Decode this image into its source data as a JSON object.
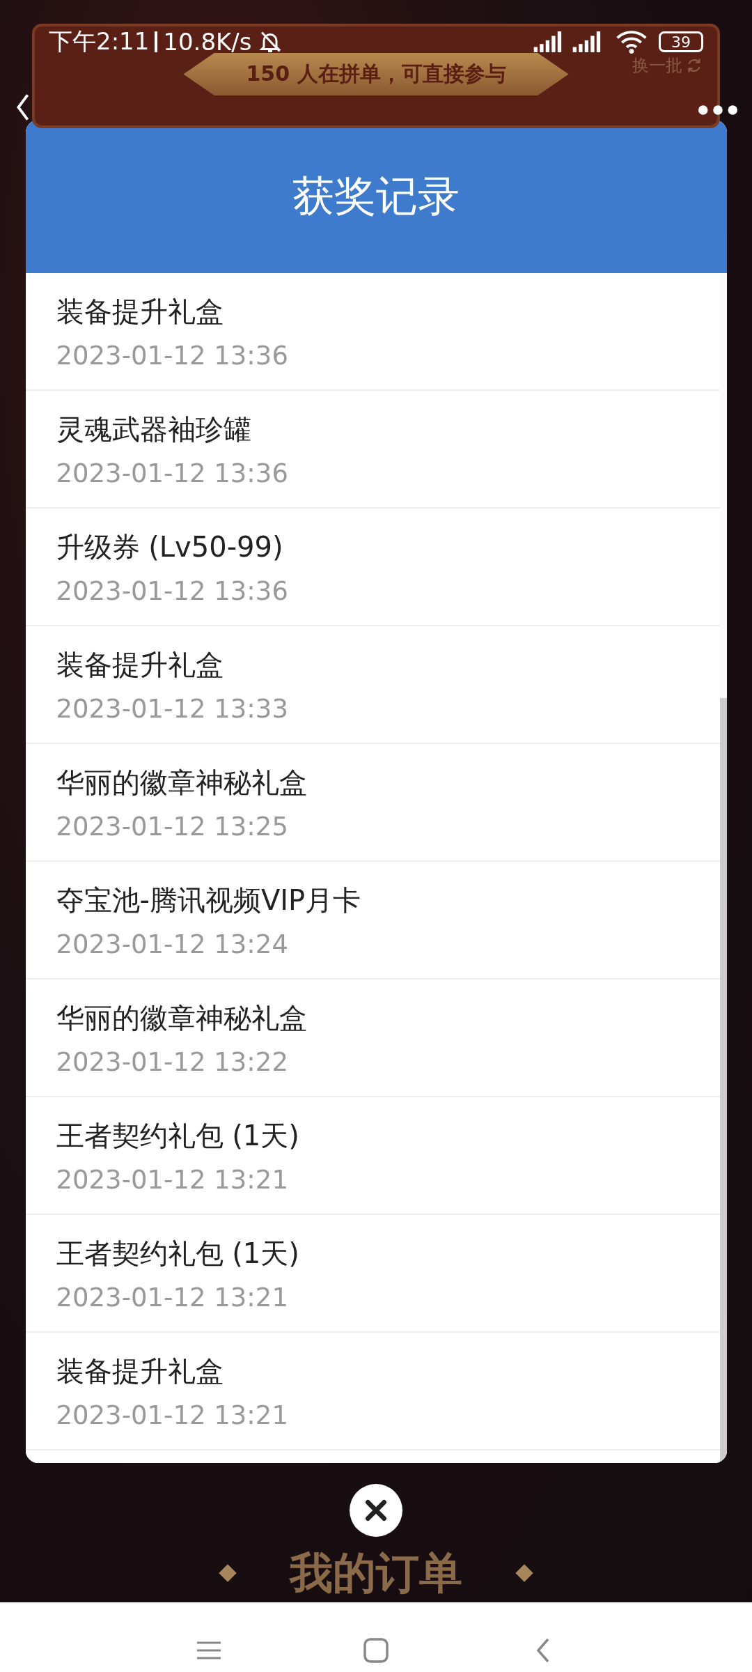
{
  "status_bar": {
    "time": "下午2:11",
    "speed": "10.8K/s",
    "battery": "39"
  },
  "banner": {
    "text": "150 人在拼单，可直接参与",
    "refresh": "换一批"
  },
  "modal": {
    "title": "获奖记录",
    "records": [
      {
        "name": "装备提升礼盒",
        "time": "2023-01-12 13:36"
      },
      {
        "name": "灵魂武器袖珍罐",
        "time": "2023-01-12 13:36"
      },
      {
        "name": "升级券 (Lv50-99)",
        "time": "2023-01-12 13:36"
      },
      {
        "name": "装备提升礼盒",
        "time": "2023-01-12 13:33"
      },
      {
        "name": "华丽的徽章神秘礼盒",
        "time": "2023-01-12 13:25"
      },
      {
        "name": "夺宝池-腾讯视频VIP月卡",
        "time": "2023-01-12 13:24"
      },
      {
        "name": "华丽的徽章神秘礼盒",
        "time": "2023-01-12 13:22"
      },
      {
        "name": "王者契约礼包 (1天)",
        "time": "2023-01-12 13:21"
      },
      {
        "name": "王者契约礼包 (1天)",
        "time": "2023-01-12 13:21"
      },
      {
        "name": "装备提升礼盒",
        "time": "2023-01-12 13:21"
      }
    ]
  },
  "section_title": "我的订单"
}
